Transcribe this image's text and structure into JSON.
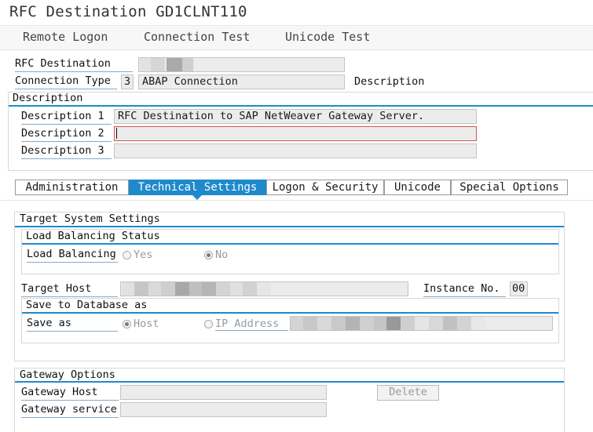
{
  "window": {
    "title": "RFC Destination GD1CLNT110"
  },
  "toolbar": {
    "items": [
      "Remote Logon",
      "Connection Test",
      "Unicode Test"
    ]
  },
  "header": {
    "rfc_destination_label": "RFC Destination",
    "rfc_destination_value": "",
    "connection_type_label": "Connection Type",
    "connection_type_code": "3",
    "connection_type_text": "ABAP Connection",
    "description_label": "Description"
  },
  "description": {
    "title": "Description",
    "d1_label": "Description 1",
    "d1_value": "RFC Destination to SAP NetWeaver Gateway Server.",
    "d2_label": "Description 2",
    "d2_value": "",
    "d3_label": "Description 3",
    "d3_value": ""
  },
  "tabs": [
    {
      "label": "Administration",
      "active": false
    },
    {
      "label": "Technical Settings",
      "active": true
    },
    {
      "label": "Logon & Security",
      "active": false
    },
    {
      "label": "Unicode",
      "active": false
    },
    {
      "label": "Special Options",
      "active": false
    }
  ],
  "target_system": {
    "title": "Target System Settings",
    "lb_status_title": "Load Balancing Status",
    "lb_label": "Load Balancing",
    "lb_yes": "Yes",
    "lb_no": "No",
    "lb_selected": "No",
    "target_host_label": "Target Host",
    "target_host_value": "",
    "instance_label": "Instance No.",
    "instance_value": "00",
    "save_db_title": "Save to Database as",
    "save_as_label": "Save as",
    "save_host": "Host",
    "save_ip": "IP Address",
    "save_selected": "Host",
    "save_value": ""
  },
  "gateway": {
    "title": "Gateway Options",
    "host_label": "Gateway Host",
    "host_value": "",
    "delete_label": "Delete",
    "service_label": "Gateway service",
    "service_value": ""
  },
  "colors": {
    "accent": "#1e8acc",
    "field_bg": "#ececec",
    "mandatory_marker": "#d9534f"
  }
}
